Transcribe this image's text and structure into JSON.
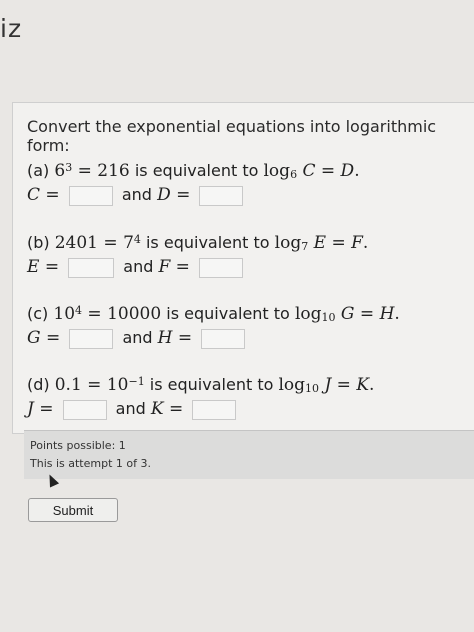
{
  "header": {
    "title": "iz"
  },
  "question": {
    "prompt": "Convert the exponential equations into logarithmic form:",
    "parts": [
      {
        "label": "(a)",
        "base": "6",
        "exp": "3",
        "value": "216",
        "text": "is equivalent to",
        "log_base": "6",
        "var1": "C",
        "var2": "D"
      },
      {
        "label": "(b)",
        "value_left": "2401",
        "base": "7",
        "exp": "4",
        "text": "is equivalent to",
        "log_base": "7",
        "var1": "E",
        "var2": "F"
      },
      {
        "label": "(c)",
        "base": "10",
        "exp": "4",
        "value": "10000",
        "text": "is equivalent to",
        "log_base": "10",
        "var1": "G",
        "var2": "H"
      },
      {
        "label": "(d)",
        "value_left": "0.1",
        "base": "10",
        "exp": "−1",
        "text": "is equivalent to",
        "log_base": "10",
        "var1": "J",
        "var2": "K"
      }
    ],
    "and_label": "and"
  },
  "points": {
    "possible": "Points possible: 1",
    "attempt": "This is attempt 1 of 3."
  },
  "submit": {
    "label": "Submit"
  }
}
